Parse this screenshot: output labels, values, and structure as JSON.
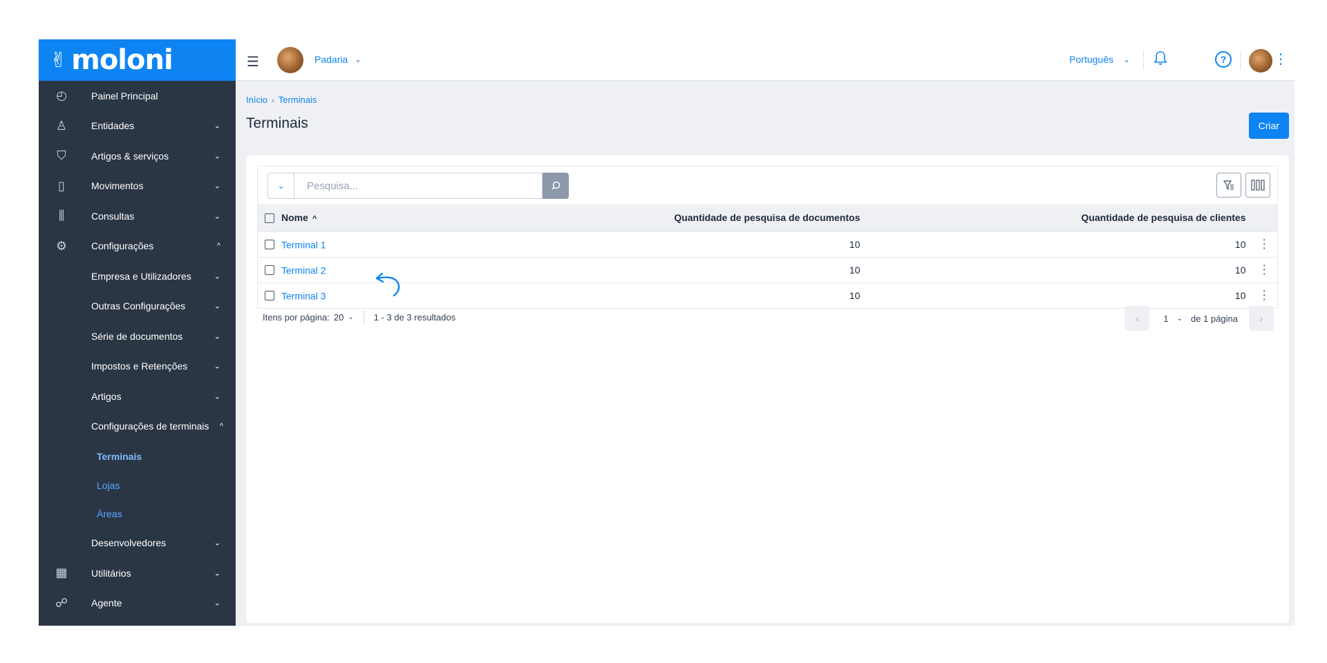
{
  "brand": {
    "mark": "✌",
    "name": "moloni",
    "color": "#0d84f2"
  },
  "sidebar": {
    "items": [
      {
        "label": "Painel Principal",
        "icon": "dashboard-icon",
        "glyph": "◴",
        "chevron": ""
      },
      {
        "label": "Entidades",
        "icon": "user-icon",
        "glyph": "♙",
        "chevron": "⌄"
      },
      {
        "label": "Artigos & serviços",
        "icon": "basket-icon",
        "glyph": "⛉",
        "chevron": "⌄"
      },
      {
        "label": "Movimentos",
        "icon": "document-icon",
        "glyph": "▯",
        "chevron": "⌄"
      },
      {
        "label": "Consultas",
        "icon": "bar-chart-icon",
        "glyph": "⫼",
        "chevron": "⌄"
      },
      {
        "label": "Configurações",
        "icon": "gear-icon",
        "glyph": "⚙",
        "chevron": "^"
      },
      {
        "label": "Empresa e Utilizadores",
        "chevron": "⌄"
      },
      {
        "label": "Outras Configurações",
        "chevron": "⌄"
      },
      {
        "label": "Série de documentos",
        "chevron": "⌄"
      },
      {
        "label": "Impostos e Retenções",
        "chevron": "⌄"
      },
      {
        "label": "Artigos",
        "chevron": "⌄"
      },
      {
        "label": "Configurações de terminais",
        "chevron": "^"
      },
      {
        "label": "Terminais"
      },
      {
        "label": "Lojas"
      },
      {
        "label": "Áreas"
      },
      {
        "label": "Desenvolvedores",
        "chevron": "⌄"
      },
      {
        "label": "Utilitários",
        "icon": "calendar-icon",
        "glyph": "▦",
        "chevron": "⌄"
      },
      {
        "label": "Agente",
        "icon": "network-icon",
        "glyph": "☍",
        "chevron": "⌄"
      }
    ]
  },
  "topbar": {
    "menu_icon": "☰",
    "store_name": "Padaria",
    "chevron": "⌄",
    "language": "Português",
    "bell": "🔔",
    "help": "?",
    "kebab": "⋮"
  },
  "breadcrumb": {
    "home": "Início",
    "separator": "›",
    "current": "Terminais"
  },
  "page": {
    "title": "Terminais",
    "create_label": "Criar"
  },
  "search": {
    "placeholder": "Pesquisa...",
    "dropdown": "⌄",
    "button": "⌕"
  },
  "toolbar": {
    "filter_glyph": "⚲",
    "columns_glyph": "▯▯▯"
  },
  "table": {
    "headers": {
      "name": "Nome",
      "sort": "^",
      "docs": "Quantidade de pesquisa de documentos",
      "clients": "Quantidade de pesquisa de clientes"
    },
    "rows": [
      {
        "name": "Terminal 1",
        "docs": "10",
        "clients": "10"
      },
      {
        "name": "Terminal 2",
        "docs": "10",
        "clients": "10"
      },
      {
        "name": "Terminal 3",
        "docs": "10",
        "clients": "10"
      }
    ],
    "row_action": "⋮"
  },
  "pagination": {
    "per_page_label": "Itens por página:",
    "per_page_value": "20",
    "chevron": "⌄",
    "summary": "1 - 3 de 3 resultados",
    "prev": "‹",
    "page": "1",
    "of_pages": "de 1 página",
    "next": "›"
  }
}
